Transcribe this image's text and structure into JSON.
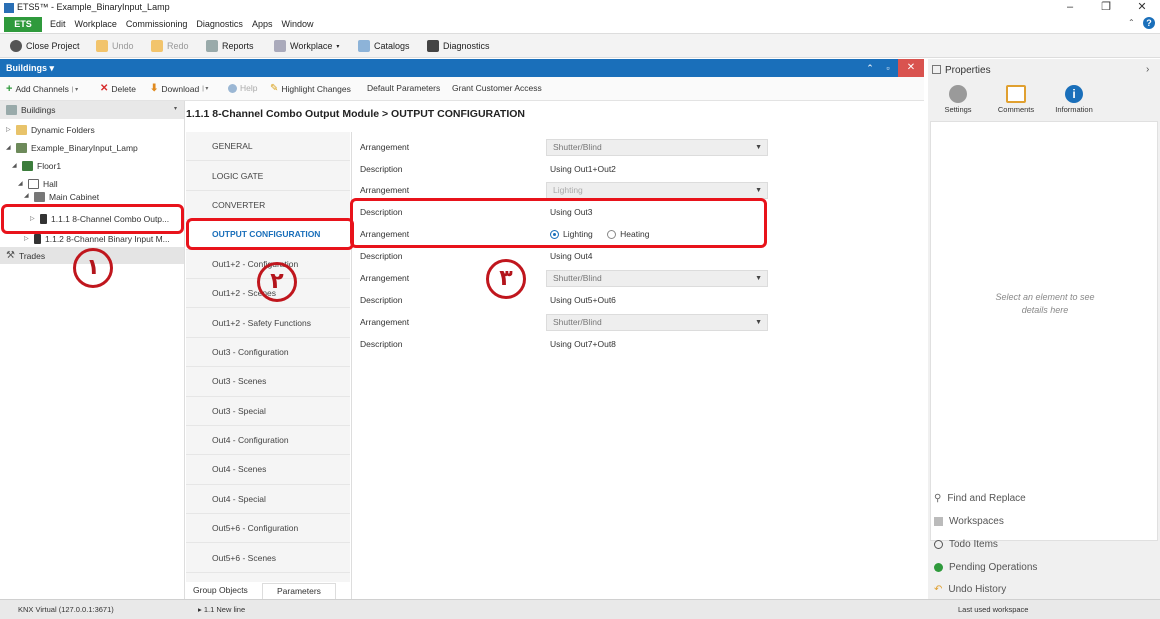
{
  "window": {
    "title": "ETS5™ - Example_BinaryInput_Lamp",
    "controls": [
      "–",
      "❐",
      "✕"
    ]
  },
  "menubar": {
    "ets_label": "ETS",
    "items": [
      "Edit",
      "Workplace",
      "Commissioning",
      "Diagnostics",
      "Apps",
      "Window"
    ]
  },
  "toolbar": {
    "close_project": "Close Project",
    "undo": "Undo",
    "redo": "Redo",
    "reports": "Reports",
    "workplace": "Workplace",
    "catalogs": "Catalogs",
    "diagnostics": "Diagnostics"
  },
  "panel": {
    "title": "Buildings",
    "subtoolbar": {
      "add_channels": "Add Channels",
      "delete": "Delete",
      "download": "Download",
      "help": "Help",
      "highlight_changes": "Highlight Changes",
      "default_parameters": "Default Parameters",
      "grant_customer_access": "Grant Customer Access"
    }
  },
  "tree": {
    "header": "Buildings",
    "nodes": [
      {
        "label": "Dynamic Folders"
      },
      {
        "label": "Example_BinaryInput_Lamp"
      },
      {
        "label": "Floor1"
      },
      {
        "label": "Hall"
      },
      {
        "label": "Main Cabinet"
      },
      {
        "label": "1.1.1 8-Channel Combo Outp..."
      },
      {
        "label": "1.1.2 8-Channel Binary Input M..."
      }
    ],
    "trades": "Trades"
  },
  "breadcrumb": "1.1.1 8-Channel Combo Output Module > OUTPUT CONFIGURATION",
  "nav": {
    "items": [
      "GENERAL",
      "LOGIC GATE",
      "CONVERTER",
      "OUTPUT CONFIGURATION",
      "Out1+2 - Configuration",
      "Out1+2 - Scenes",
      "Out1+2 - Safety Functions",
      "Out3 - Configuration",
      "Out3 - Scenes",
      "Out3 - Special",
      "Out4 - Configuration",
      "Out4 - Scenes",
      "Out4 - Special",
      "Out5+6 - Configuration",
      "Out5+6 - Scenes"
    ],
    "active_index": 3,
    "tabs": [
      "Group Objects",
      "Parameters"
    ]
  },
  "params": {
    "rows": [
      {
        "label": "Arrangement",
        "kind": "select",
        "value": "Shutter/Blind"
      },
      {
        "label": "Description",
        "kind": "text",
        "value": "Using Out1+Out2"
      },
      {
        "label": "Arrangement",
        "kind": "select",
        "value": "Lighting"
      },
      {
        "label": "Description",
        "kind": "text",
        "value": "Using Out3"
      },
      {
        "label": "Arrangement",
        "kind": "radio",
        "options": [
          "Lighting",
          "Heating"
        ],
        "selected": "Lighting"
      },
      {
        "label": "Description",
        "kind": "text",
        "value": "Using Out4"
      },
      {
        "label": "Arrangement",
        "kind": "select",
        "value": "Shutter/Blind"
      },
      {
        "label": "Description",
        "kind": "text",
        "value": "Using Out5+Out6"
      },
      {
        "label": "Arrangement",
        "kind": "select",
        "value": "Shutter/Blind"
      },
      {
        "label": "Description",
        "kind": "text",
        "value": "Using Out7+Out8"
      }
    ]
  },
  "properties": {
    "title": "Properties",
    "tabs": [
      "Settings",
      "Comments",
      "Information"
    ],
    "hint": "Select an element to see details here",
    "links": [
      "Find and Replace",
      "Workspaces",
      "Todo Items",
      "Pending Operations",
      "Undo History"
    ]
  },
  "statusbar": {
    "connection": "KNX Virtual (127.0.0.1:3671)",
    "line": "1.1 New line",
    "workspace": "Last used workspace"
  },
  "annotations": {
    "markers": [
      "١",
      "٢",
      "٣"
    ]
  },
  "colors": {
    "accent": "#1a6fba",
    "ets_green": "#2f9a3c",
    "annotation_red": "#e8131b"
  }
}
